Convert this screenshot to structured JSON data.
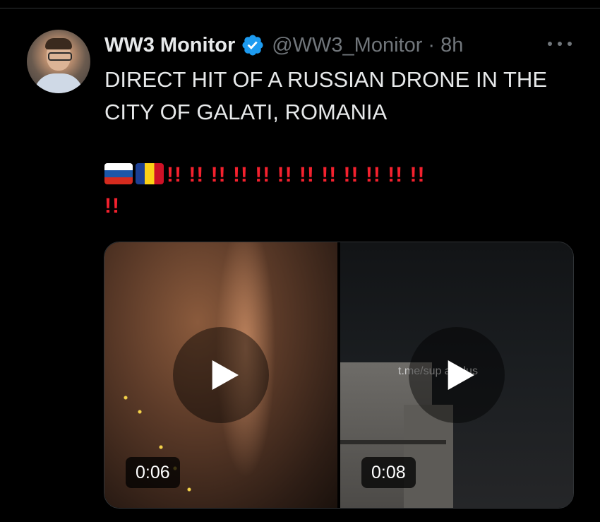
{
  "tweet": {
    "author_name": "WW3 Monitor",
    "handle_time": "@WW3_Monitor · 8h",
    "text_line1": "DIRECT HIT OF A RUSSIAN DRONE IN THE",
    "text_line2": "CITY OF GALATI, ROMANIA",
    "exclamations_line1": "!! !! !! !! !! !! !! !! !! !! !! !!",
    "exclamations_line2": "!!",
    "flags": [
      "russia-flag",
      "romania-flag"
    ],
    "verified": true
  },
  "media": {
    "videos": [
      {
        "duration": "0:06"
      },
      {
        "duration": "0:08",
        "watermark": "t.me/sup          a_plus"
      }
    ]
  },
  "icons": {
    "verified": "verified-badge-icon",
    "more": "more-options-icon",
    "play": "play-icon"
  },
  "colors": {
    "background": "#000000",
    "text": "#e7e9ea",
    "muted": "#71767b",
    "verified_blue": "#1d9bf0",
    "exclamation_red": "#f4212e"
  }
}
